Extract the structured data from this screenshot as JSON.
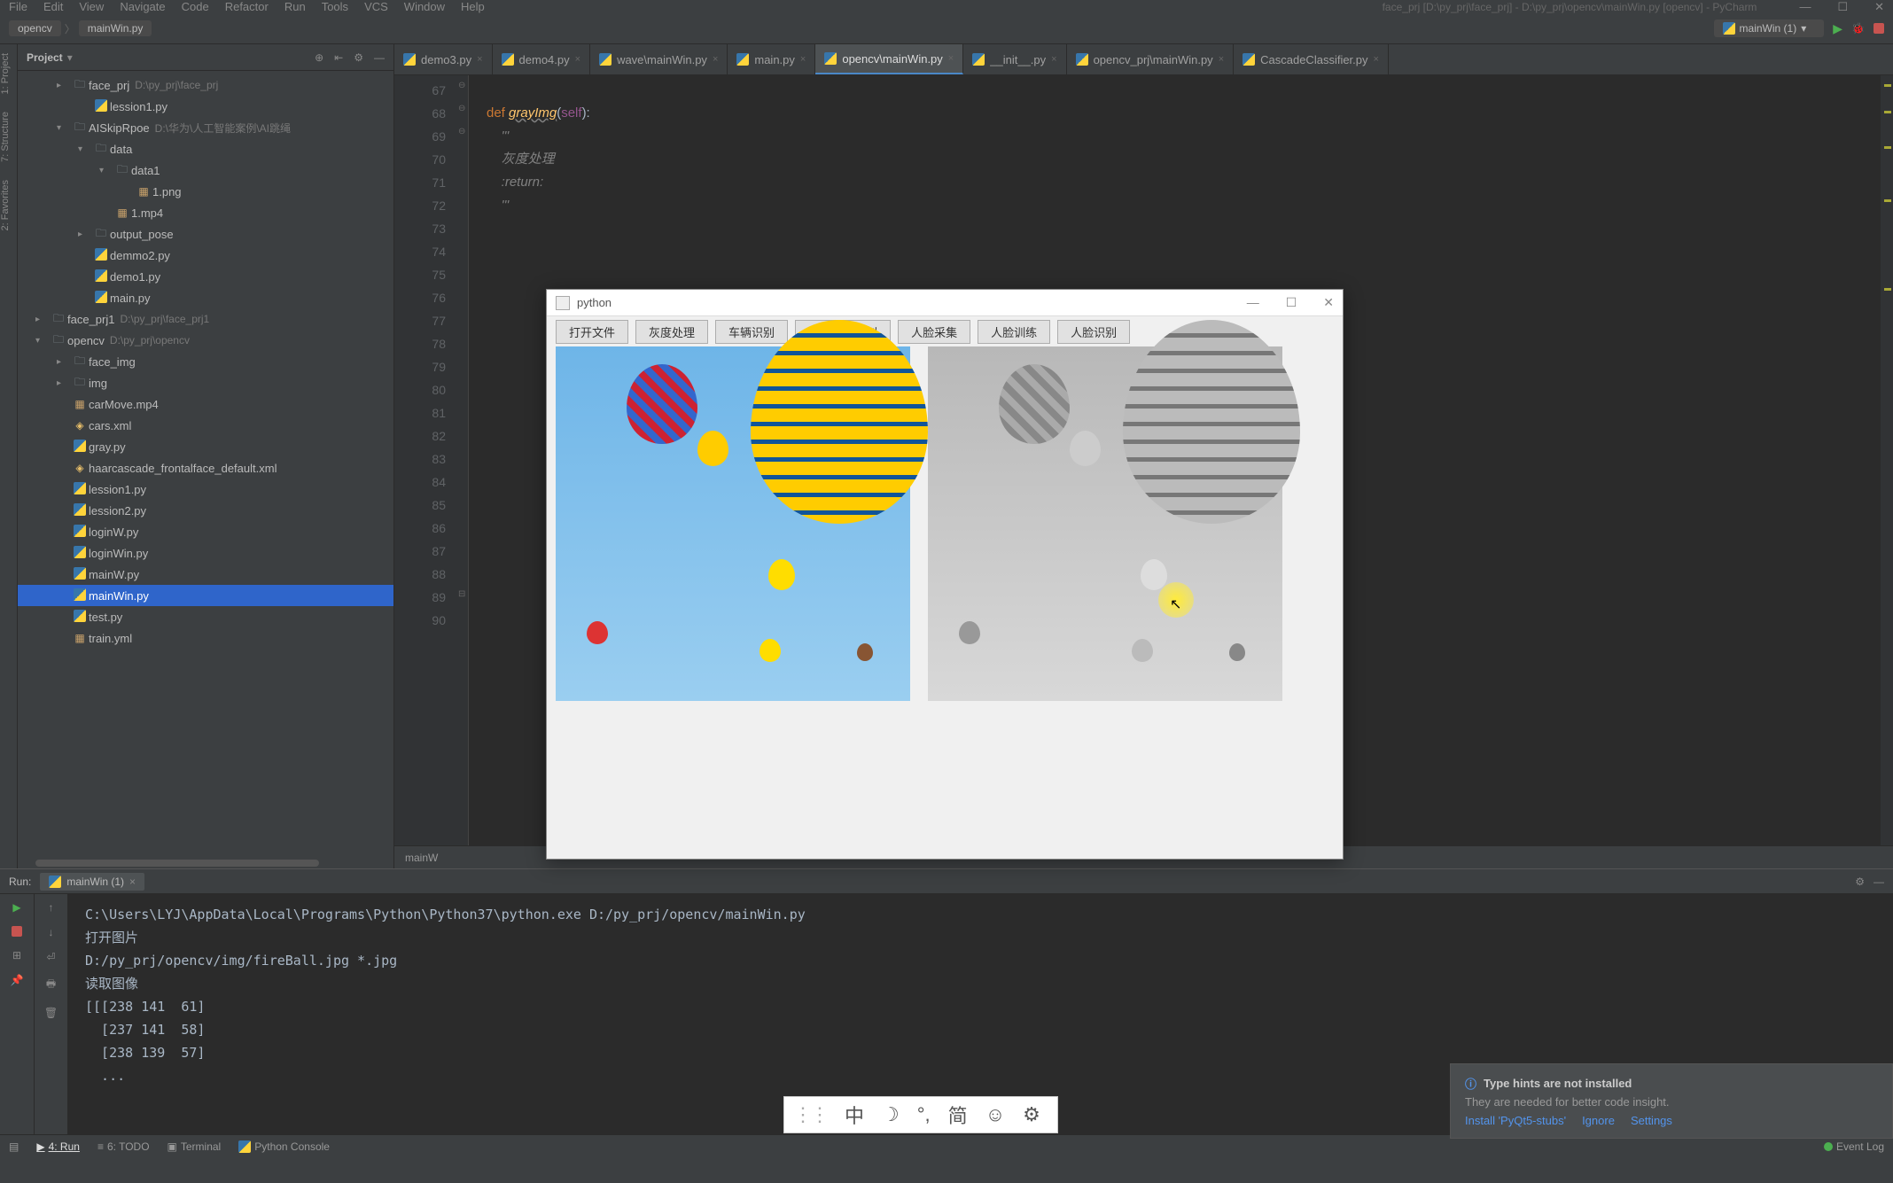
{
  "menu": [
    "File",
    "Edit",
    "View",
    "Navigate",
    "Code",
    "Refactor",
    "Run",
    "Tools",
    "VCS",
    "Window",
    "Help"
  ],
  "windowTitle": "face_prj [D:\\py_prj\\face_prj] - D:\\py_prj\\opencv\\mainWin.py [opencv] - PyCharm",
  "breadcrumb": [
    "opencv",
    "mainWin.py"
  ],
  "runConfig": "mainWin (1)",
  "leftTabs": [
    "1: Project",
    "7: Structure",
    "2: Favorites"
  ],
  "project": {
    "title": "Project",
    "tree": [
      {
        "d": 1,
        "arrow": "▸",
        "type": "folder",
        "label": "face_prj",
        "path": "D:\\py_prj\\face_prj"
      },
      {
        "d": 2,
        "arrow": "",
        "type": "py",
        "label": "lession1.py"
      },
      {
        "d": 1,
        "arrow": "▾",
        "type": "folder",
        "label": "AISkipRpoe",
        "path": "D:\\华为\\人工智能案例\\AI跳绳"
      },
      {
        "d": 2,
        "arrow": "▾",
        "type": "folder",
        "label": "data"
      },
      {
        "d": 3,
        "arrow": "▾",
        "type": "folder",
        "label": "data1"
      },
      {
        "d": 4,
        "arrow": "",
        "type": "img",
        "label": "1.png"
      },
      {
        "d": 3,
        "arrow": "",
        "type": "img",
        "label": "1.mp4"
      },
      {
        "d": 2,
        "arrow": "▸",
        "type": "folder",
        "label": "output_pose"
      },
      {
        "d": 2,
        "arrow": "",
        "type": "py",
        "label": "demmo2.py"
      },
      {
        "d": 2,
        "arrow": "",
        "type": "py",
        "label": "demo1.py"
      },
      {
        "d": 2,
        "arrow": "",
        "type": "py",
        "label": "main.py"
      },
      {
        "d": 0,
        "arrow": "▸",
        "type": "folder",
        "label": "face_prj1",
        "path": "D:\\py_prj\\face_prj1"
      },
      {
        "d": 0,
        "arrow": "▾",
        "type": "folder",
        "label": "opencv",
        "path": "D:\\py_prj\\opencv"
      },
      {
        "d": 1,
        "arrow": "▸",
        "type": "folder",
        "label": "face_img"
      },
      {
        "d": 1,
        "arrow": "▸",
        "type": "folder",
        "label": "img"
      },
      {
        "d": 1,
        "arrow": "",
        "type": "img",
        "label": "carMove.mp4"
      },
      {
        "d": 1,
        "arrow": "",
        "type": "xml",
        "label": "cars.xml"
      },
      {
        "d": 1,
        "arrow": "",
        "type": "py",
        "label": "gray.py"
      },
      {
        "d": 1,
        "arrow": "",
        "type": "xml",
        "label": "haarcascade_frontalface_default.xml"
      },
      {
        "d": 1,
        "arrow": "",
        "type": "py",
        "label": "lession1.py"
      },
      {
        "d": 1,
        "arrow": "",
        "type": "py",
        "label": "lession2.py"
      },
      {
        "d": 1,
        "arrow": "",
        "type": "py",
        "label": "loginW.py"
      },
      {
        "d": 1,
        "arrow": "",
        "type": "py",
        "label": "loginWin.py"
      },
      {
        "d": 1,
        "arrow": "",
        "type": "py",
        "label": "mainW.py"
      },
      {
        "d": 1,
        "arrow": "",
        "type": "py",
        "label": "mainWin.py",
        "selected": true
      },
      {
        "d": 1,
        "arrow": "",
        "type": "py",
        "label": "test.py"
      },
      {
        "d": 1,
        "arrow": "",
        "type": "img",
        "label": "train.yml"
      }
    ]
  },
  "tabs": [
    {
      "label": "demo3.py"
    },
    {
      "label": "demo4.py"
    },
    {
      "label": "wave\\mainWin.py"
    },
    {
      "label": "main.py"
    },
    {
      "label": "opencv\\mainWin.py",
      "active": true
    },
    {
      "label": "__init__.py"
    },
    {
      "label": "opencv_prj\\mainWin.py"
    },
    {
      "label": "CascadeClassifier.py"
    }
  ],
  "gutter": [
    "67",
    "68",
    "69",
    "70",
    "71",
    "72",
    "73",
    "74",
    "75",
    "76",
    "77",
    "78",
    "79",
    "80",
    "81",
    "82",
    "83",
    "84",
    "85",
    "86",
    "87",
    "88",
    "89",
    "90"
  ],
  "code": {
    "l1": "def ",
    "fn": "grayImg",
    "l1b": "(",
    "self": "self",
    "l1c": "):",
    "doc1": "'''",
    "doc2": "灰度处理",
    "doc3": ":return:",
    "doc4": "'''"
  },
  "breadcrumbBottom": "mainW",
  "runPanel": {
    "label": "Run:",
    "tab": "mainWin (1)"
  },
  "console": [
    "C:\\Users\\LYJ\\AppData\\Local\\Programs\\Python\\Python37\\python.exe D:/py_prj/opencv/mainWin.py",
    "打开图片",
    "D:/py_prj/opencv/img/fireBall.jpg *.jpg",
    "读取图像",
    "[[[238 141  61]",
    "  [237 141  58]",
    "  [238 139  57]",
    "  ..."
  ],
  "bottomTools": [
    "4: Run",
    "6: TODO",
    "Terminal",
    "Python Console"
  ],
  "eventLog": "Event Log",
  "notification": {
    "title": "Type hints are not installed",
    "body": "They are needed for better code insight.",
    "links": [
      "Install 'PyQt5-stubs'",
      "Ignore",
      "Settings"
    ]
  },
  "appWindow": {
    "title": "python",
    "buttons": [
      "打开文件",
      "灰度处理",
      "车辆识别",
      "视频车辆识别",
      "人脸采集",
      "人脸训练",
      "人脸识别"
    ]
  },
  "ime": [
    "中",
    "☽",
    "°,",
    "简",
    "☺",
    "⚙"
  ]
}
